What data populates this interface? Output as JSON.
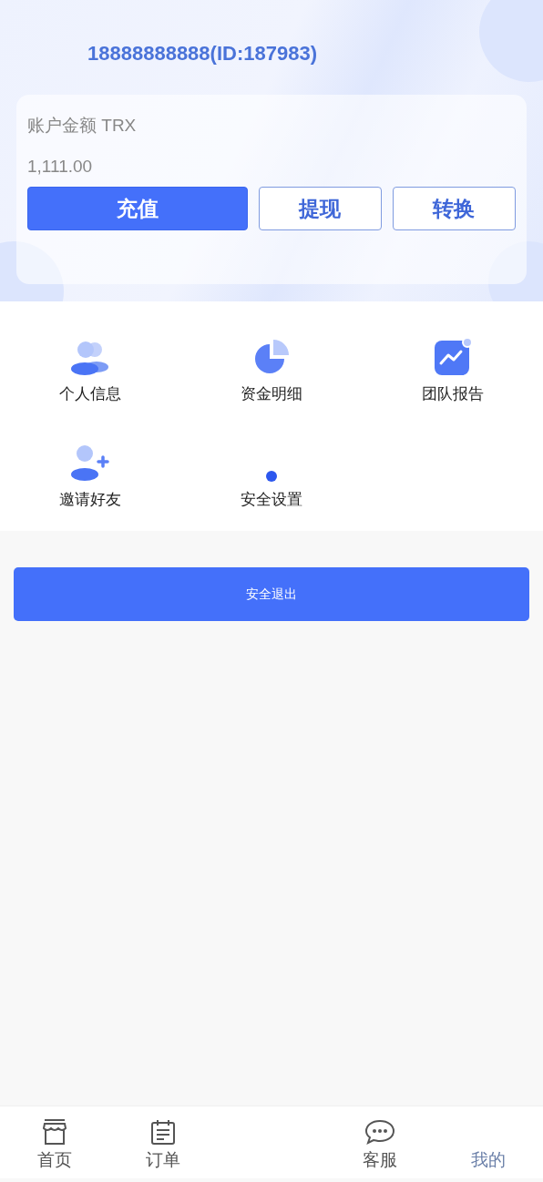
{
  "header": {
    "title": "18888888888(ID:187983)"
  },
  "account": {
    "label": "账户金额 TRX",
    "balance": "1,111.00",
    "buttons": [
      {
        "label": "充值",
        "kind": "primary"
      },
      {
        "label": "提现",
        "kind": "outline"
      },
      {
        "label": "转换",
        "kind": "outline"
      }
    ]
  },
  "menu": [
    {
      "label": "个人信息",
      "kind": "users"
    },
    {
      "label": "资金明细",
      "kind": "pie"
    },
    {
      "label": "团队报告",
      "kind": "chart"
    },
    {
      "label": "邀请好友",
      "kind": "add-user"
    },
    {
      "label": "安全设置",
      "kind": "dot"
    }
  ],
  "logout": {
    "label": "安全退出"
  },
  "tabbar": [
    {
      "label": "首页",
      "kind": "store",
      "selected": false
    },
    {
      "label": "订单",
      "kind": "calendar",
      "selected": false
    },
    {
      "label": "客服",
      "kind": "chat",
      "selected": false
    },
    {
      "label": "我的",
      "kind": "none",
      "selected": true
    }
  ]
}
